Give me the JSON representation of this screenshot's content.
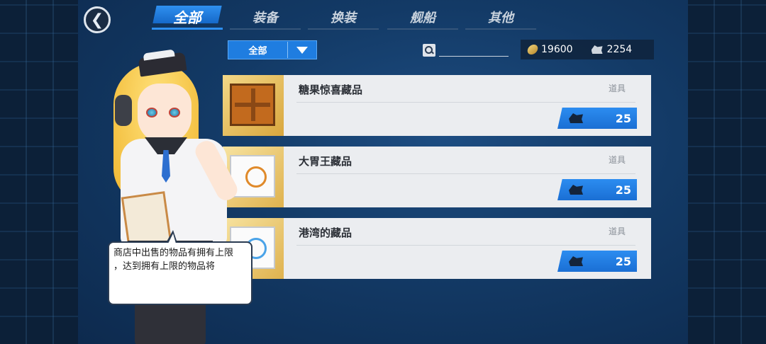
{
  "header": {
    "back_symbol": "❮",
    "tabs": [
      {
        "label": "全部",
        "active": true
      },
      {
        "label": "装备",
        "active": false
      },
      {
        "label": "换装",
        "active": false
      },
      {
        "label": "舰船",
        "active": false
      },
      {
        "label": "其他",
        "active": false
      }
    ]
  },
  "toolbar": {
    "filter_label": "全部",
    "search_placeholder": "",
    "search_value": ""
  },
  "currency": {
    "coins": "19600",
    "ships": "2254"
  },
  "items": [
    {
      "name": "糖果惊喜藏品",
      "type": "道具",
      "price": "25",
      "thumb": "wooden-crate-icon"
    },
    {
      "name": "大胃王藏品",
      "type": "道具",
      "price": "25",
      "thumb": "orange-box-icon"
    },
    {
      "name": "港湾的藏品",
      "type": "道具",
      "price": "25",
      "thumb": "blue-box-icon"
    }
  ],
  "dialog": {
    "line1": "商店中出售的物品有拥有上限",
    "line2": "，达到拥有上限的物品将"
  },
  "colors": {
    "accent": "#1f7de0",
    "panel": "#ebedf0",
    "item_thumb": "#e6b94a"
  }
}
